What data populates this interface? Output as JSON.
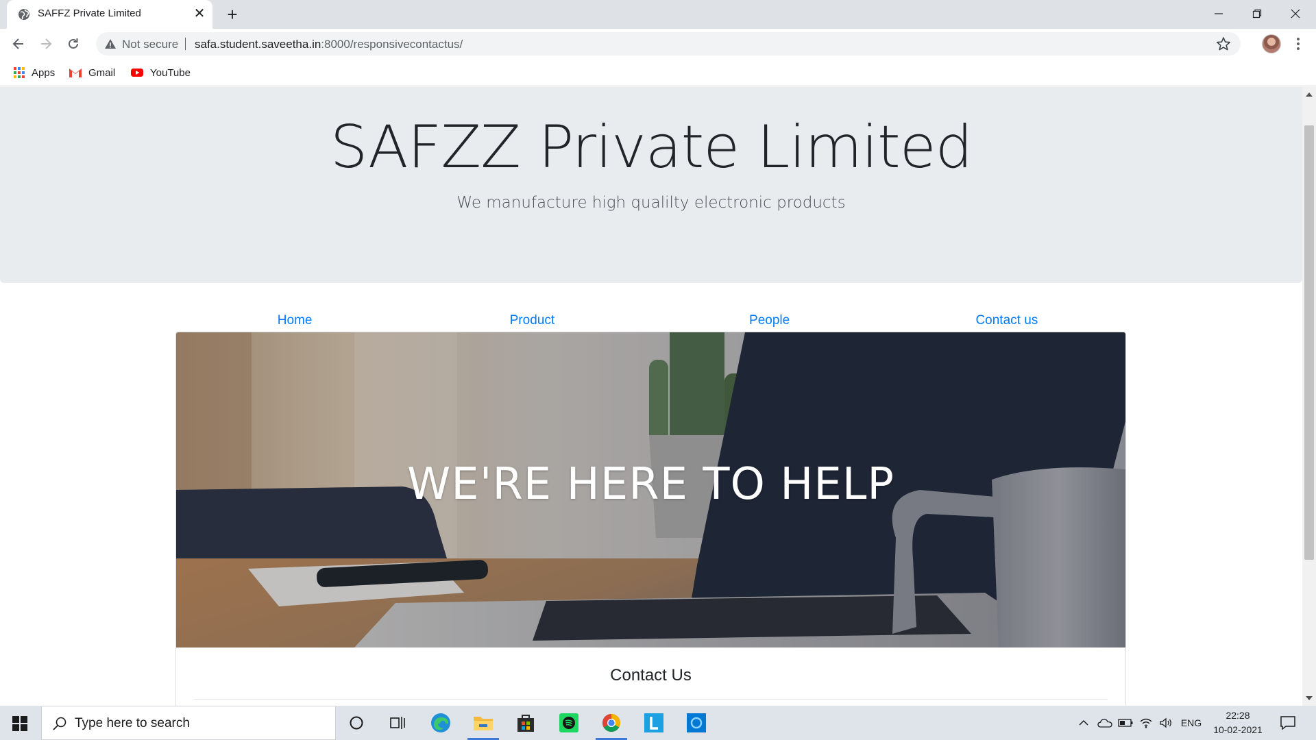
{
  "browser": {
    "tab_title": "SAFFZ Private Limited",
    "security_label": "Not secure",
    "url_host": "safa.student.saveetha.in",
    "url_rest": ":8000/responsivecontactus/",
    "bookmarks": [
      "Apps",
      "Gmail",
      "YouTube"
    ]
  },
  "page": {
    "brand_title": "SAFZZ Private Limited",
    "brand_subtitle": "We manufacture high qualilty electronic products",
    "nav": [
      "Home",
      "Product",
      "People",
      "Contact us"
    ],
    "hero_text": "WE'RE HERE TO HELP",
    "contact_heading": "Contact Us"
  },
  "taskbar": {
    "search_placeholder": "Type here to search",
    "language": "ENG",
    "time": "22:28",
    "date": "10-02-2021",
    "apps": [
      "cortana-icon",
      "task-view-icon",
      "edge-icon",
      "file-explorer-icon",
      "store-icon",
      "spotify-icon",
      "chrome-icon",
      "l-app-icon",
      "app-icon"
    ]
  },
  "colors": {
    "link": "#007bff",
    "jumbotron_bg": "#e9ecef",
    "taskbar_bg": "#dfe3ea"
  }
}
